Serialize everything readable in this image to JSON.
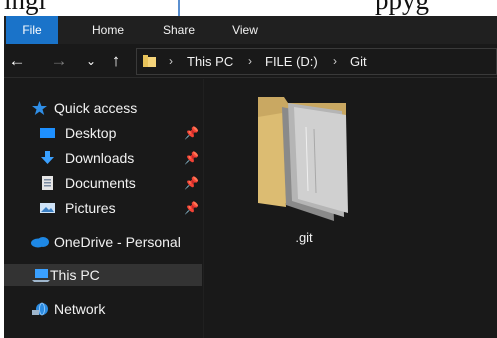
{
  "document": {
    "text_left": "ingi",
    "text_right": "ppyg"
  },
  "ribbon": {
    "tabs": [
      "File",
      "Home",
      "Share",
      "View"
    ]
  },
  "nav": {
    "back": "←",
    "forward": "→",
    "recent": "⌄",
    "up": "↑"
  },
  "address": {
    "parts": [
      "This PC",
      "FILE (D:)",
      "Git"
    ],
    "separator": "›"
  },
  "sidebar": {
    "quick_access": "Quick access",
    "pinned": [
      {
        "label": "Desktop",
        "icon": "desktop-icon"
      },
      {
        "label": "Downloads",
        "icon": "downloads-icon"
      },
      {
        "label": "Documents",
        "icon": "documents-icon"
      },
      {
        "label": "Pictures",
        "icon": "pictures-icon"
      }
    ],
    "onedrive": "OneDrive - Personal",
    "this_pc": "This PC",
    "network": "Network"
  },
  "content": {
    "items": [
      {
        "name": ".git",
        "type": "folder"
      }
    ]
  },
  "colors": {
    "file_tab": "#1a73c9",
    "window_bg": "#191919",
    "folder": "#d9b86b",
    "selected": "#333333"
  }
}
